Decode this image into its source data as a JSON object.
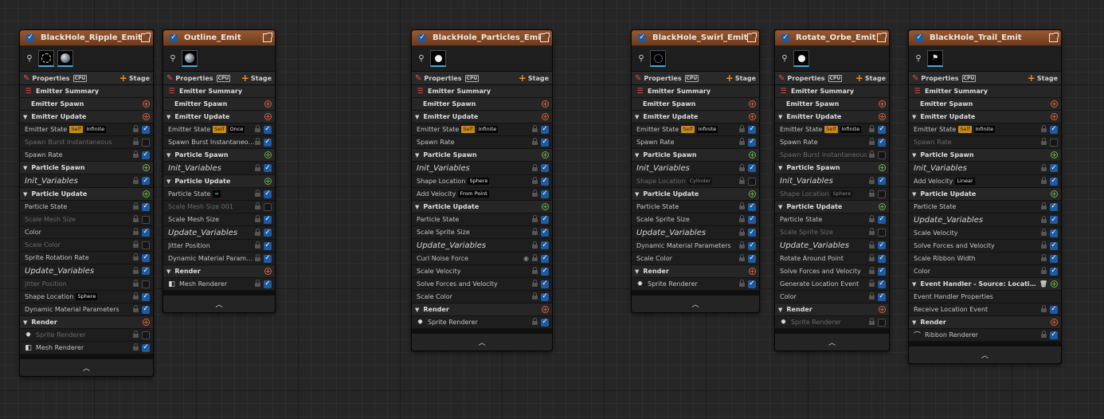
{
  "emitters": [
    {
      "title": "BlackHole_Ripple_Emit",
      "thumb": "ripple",
      "properties_label": "Properties",
      "cpu_label": "CPU",
      "stage_label": "Stage",
      "rows": [
        {
          "kind": "summary",
          "label": "Emitter Summary"
        },
        {
          "kind": "spawnh",
          "label": "Emitter Spawn",
          "add": "red"
        },
        {
          "kind": "header",
          "label": "Emitter Update",
          "add": "red"
        },
        {
          "kind": "item",
          "label": "Emitter State",
          "self": "Self",
          "badge": "Infinite",
          "checked": true
        },
        {
          "kind": "item",
          "label": "Spawn Burst Instantaneous",
          "dim": true,
          "checked": false
        },
        {
          "kind": "item",
          "label": "Spawn Rate",
          "checked": true
        },
        {
          "kind": "header",
          "label": "Particle Spawn",
          "add": "green"
        },
        {
          "kind": "item",
          "label": "Init_Variables",
          "italic": true,
          "checked": true
        },
        {
          "kind": "header",
          "label": "Particle Update",
          "add": "green"
        },
        {
          "kind": "item",
          "label": "Particle State",
          "checked": true
        },
        {
          "kind": "item",
          "label": "Scale Mesh Size",
          "dim": true,
          "checked": false
        },
        {
          "kind": "item",
          "label": "Color",
          "checked": true
        },
        {
          "kind": "item",
          "label": "Scale Color",
          "dim": true,
          "checked": false
        },
        {
          "kind": "item",
          "label": "Sprite Rotation Rate",
          "checked": true
        },
        {
          "kind": "item",
          "label": "Update_Variables",
          "italic": true,
          "checked": true
        },
        {
          "kind": "item",
          "label": "Jitter Position",
          "dim": true,
          "checked": false
        },
        {
          "kind": "item",
          "label": "Shape Location",
          "badge": "Sphere",
          "checked": true
        },
        {
          "kind": "item",
          "label": "Dynamic Material Parameters",
          "checked": true
        },
        {
          "kind": "header",
          "label": "Render",
          "add": "red"
        },
        {
          "kind": "item",
          "label": "Sprite Renderer",
          "icon": "sprite-icon",
          "dim": true,
          "checked": false
        },
        {
          "kind": "item",
          "label": "Mesh Renderer",
          "icon": "mesh-icon",
          "checked": true
        }
      ]
    },
    {
      "title": "Outline_Emit",
      "thumb": "sphere",
      "properties_label": "Properties",
      "cpu_label": "CPU",
      "stage_label": "Stage",
      "rows": [
        {
          "kind": "summary",
          "label": "Emitter Summary"
        },
        {
          "kind": "spawnh",
          "label": "Emitter Spawn",
          "add": "red"
        },
        {
          "kind": "header",
          "label": "Emitter Update",
          "add": "red"
        },
        {
          "kind": "item",
          "label": "Emitter State",
          "self": "Self",
          "badge": "Once",
          "checked": true
        },
        {
          "kind": "item",
          "label": "Spawn Burst Instantaneous",
          "checked": true
        },
        {
          "kind": "header",
          "label": "Particle Spawn",
          "add": "green"
        },
        {
          "kind": "item",
          "label": "Init_Variables",
          "italic": true,
          "checked": true
        },
        {
          "kind": "header",
          "label": "Particle Update",
          "add": "green"
        },
        {
          "kind": "item",
          "label": "Particle State",
          "badge": "∞",
          "badgeInf": true,
          "checked": true
        },
        {
          "kind": "item",
          "label": "Scale Mesh Size 001",
          "dim": true,
          "checked": false
        },
        {
          "kind": "item",
          "label": "Scale Mesh Size",
          "checked": true
        },
        {
          "kind": "item",
          "label": "Update_Variables",
          "italic": true,
          "checked": true
        },
        {
          "kind": "item",
          "label": "Jitter Position",
          "checked": true
        },
        {
          "kind": "item",
          "label": "Dynamic Material Parameters",
          "checked": true
        },
        {
          "kind": "header",
          "label": "Render",
          "add": "red"
        },
        {
          "kind": "item",
          "label": "Mesh Renderer",
          "icon": "mesh-icon",
          "checked": true
        }
      ]
    },
    {
      "title": "BlackHole_Particles_Emit",
      "thumb": "dot",
      "properties_label": "Properties",
      "cpu_label": "CPU",
      "stage_label": "Stage",
      "rows": [
        {
          "kind": "summary",
          "label": "Emitter Summary"
        },
        {
          "kind": "spawnh",
          "label": "Emitter Spawn",
          "add": "red"
        },
        {
          "kind": "header",
          "label": "Emitter Update",
          "add": "red"
        },
        {
          "kind": "item",
          "label": "Emitter State",
          "self": "Self",
          "badge": "Infinite",
          "checked": true
        },
        {
          "kind": "item",
          "label": "Spawn Rate",
          "checked": true
        },
        {
          "kind": "header",
          "label": "Particle Spawn",
          "add": "green"
        },
        {
          "kind": "item",
          "label": "Init_Variables",
          "italic": true,
          "checked": true
        },
        {
          "kind": "item",
          "label": "Shape Location",
          "badge": "Sphere",
          "checked": true
        },
        {
          "kind": "item",
          "label": "Add Velocity",
          "badge": "From Point",
          "checked": true
        },
        {
          "kind": "header",
          "label": "Particle Update",
          "add": "green"
        },
        {
          "kind": "item",
          "label": "Particle State",
          "checked": true
        },
        {
          "kind": "item",
          "label": "Scale Sprite Size",
          "checked": true
        },
        {
          "kind": "item",
          "label": "Update_Variables",
          "italic": true,
          "checked": true
        },
        {
          "kind": "item",
          "label": "Curl Noise Force",
          "eye": true,
          "checked": true
        },
        {
          "kind": "item",
          "label": "Scale Velocity",
          "checked": true
        },
        {
          "kind": "item",
          "label": "Solve Forces and Velocity",
          "checked": true
        },
        {
          "kind": "item",
          "label": "Scale Color",
          "checked": true
        },
        {
          "kind": "header",
          "label": "Render",
          "add": "red"
        },
        {
          "kind": "item",
          "label": "Sprite Renderer",
          "icon": "sprite-icon",
          "checked": true
        }
      ]
    },
    {
      "title": "BlackHole_Swirl_Emit",
      "thumb": "swirl",
      "properties_label": "Properties",
      "cpu_label": "CPU",
      "stage_label": "Stage",
      "rows": [
        {
          "kind": "summary",
          "label": "Emitter Summary"
        },
        {
          "kind": "spawnh",
          "label": "Emitter Spawn",
          "add": "red"
        },
        {
          "kind": "header",
          "label": "Emitter Update",
          "add": "red"
        },
        {
          "kind": "item",
          "label": "Emitter State",
          "self": "Self",
          "badge": "Infinite",
          "checked": true
        },
        {
          "kind": "item",
          "label": "Spawn Rate",
          "checked": true
        },
        {
          "kind": "header",
          "label": "Particle Spawn",
          "add": "green"
        },
        {
          "kind": "item",
          "label": "Init_Variables",
          "italic": true,
          "checked": true
        },
        {
          "kind": "item",
          "label": "Shape Location",
          "badge": "Cylinder",
          "dim": true,
          "checked": false
        },
        {
          "kind": "header",
          "label": "Particle Update",
          "add": "green"
        },
        {
          "kind": "item",
          "label": "Particle State",
          "checked": true
        },
        {
          "kind": "item",
          "label": "Scale Sprite Size",
          "checked": true
        },
        {
          "kind": "item",
          "label": "Update_Variables",
          "italic": true,
          "checked": true
        },
        {
          "kind": "item",
          "label": "Dynamic Material Parameters",
          "checked": true
        },
        {
          "kind": "item",
          "label": "Scale Color",
          "checked": true
        },
        {
          "kind": "header",
          "label": "Render",
          "add": "red"
        },
        {
          "kind": "item",
          "label": "Sprite Renderer",
          "icon": "sprite-icon",
          "checked": true
        }
      ]
    },
    {
      "title": "Rotate_Orbe_Emit",
      "thumb": "dot",
      "properties_label": "Properties",
      "cpu_label": "CPU",
      "stage_label": "Stage",
      "rows": [
        {
          "kind": "summary",
          "label": "Emitter Summary"
        },
        {
          "kind": "spawnh",
          "label": "Emitter Spawn",
          "add": "red"
        },
        {
          "kind": "header",
          "label": "Emitter Update",
          "add": "red"
        },
        {
          "kind": "item",
          "label": "Emitter State",
          "self": "Self",
          "badge": "Infinite",
          "checked": true
        },
        {
          "kind": "item",
          "label": "Spawn Rate",
          "checked": true
        },
        {
          "kind": "item",
          "label": "Spawn Burst Instantaneous",
          "dim": true,
          "checked": false
        },
        {
          "kind": "header",
          "label": "Particle Spawn",
          "add": "green"
        },
        {
          "kind": "item",
          "label": "Init_Variables",
          "italic": true,
          "checked": true
        },
        {
          "kind": "item",
          "label": "Shape Location",
          "badge": "Sphere",
          "dim": true,
          "checked": false
        },
        {
          "kind": "header",
          "label": "Particle Update",
          "add": "green"
        },
        {
          "kind": "item",
          "label": "Particle State",
          "checked": true
        },
        {
          "kind": "item",
          "label": "Scale Sprite Size",
          "dim": true,
          "checked": false
        },
        {
          "kind": "item",
          "label": "Update_Variables",
          "italic": true,
          "checked": true
        },
        {
          "kind": "item",
          "label": "Rotate Around Point",
          "checked": true
        },
        {
          "kind": "item",
          "label": "Solve Forces and Velocity",
          "checked": true
        },
        {
          "kind": "item",
          "label": "Generate Location Event",
          "checked": true
        },
        {
          "kind": "item",
          "label": "Color",
          "checked": true
        },
        {
          "kind": "header",
          "label": "Render",
          "add": "red"
        },
        {
          "kind": "item",
          "label": "Sprite Renderer",
          "icon": "sprite-icon",
          "dim": true,
          "checked": false
        }
      ]
    },
    {
      "title": "BlackHole_Trail_Emit",
      "thumb": "trail",
      "properties_label": "Properties",
      "cpu_label": "CPU",
      "stage_label": "Stage",
      "rows": [
        {
          "kind": "summary",
          "label": "Emitter Summary"
        },
        {
          "kind": "spawnh",
          "label": "Emitter Spawn",
          "add": "red"
        },
        {
          "kind": "header",
          "label": "Emitter Update",
          "add": "red"
        },
        {
          "kind": "item",
          "label": "Emitter State",
          "self": "Self",
          "badge": "Infinite",
          "checked": true
        },
        {
          "kind": "item",
          "label": "Spawn Rate",
          "dim": true,
          "checked": false
        },
        {
          "kind": "header",
          "label": "Particle Spawn",
          "add": "green"
        },
        {
          "kind": "item",
          "label": "Init_Variables",
          "italic": true,
          "checked": true
        },
        {
          "kind": "item",
          "label": "Add Velocity",
          "badge": "Linear",
          "checked": true
        },
        {
          "kind": "header",
          "label": "Particle Update",
          "add": "green"
        },
        {
          "kind": "item",
          "label": "Particle State",
          "checked": true
        },
        {
          "kind": "item",
          "label": "Update_Variables",
          "italic": true,
          "checked": true
        },
        {
          "kind": "item",
          "label": "Scale Velocity",
          "checked": true
        },
        {
          "kind": "item",
          "label": "Solve Forces and Velocity",
          "checked": true
        },
        {
          "kind": "item",
          "label": "Scale Ribbon Width",
          "checked": true
        },
        {
          "kind": "item",
          "label": "Color",
          "checked": true
        },
        {
          "kind": "header",
          "label": "Event Handler - Source: LocationEvent",
          "add": "green",
          "trash": true
        },
        {
          "kind": "item",
          "label": "Event Handler Properties",
          "nocheck": true
        },
        {
          "kind": "item",
          "label": "Receive Location Event",
          "checked": true
        },
        {
          "kind": "header",
          "label": "Render",
          "add": "red"
        },
        {
          "kind": "item",
          "label": "Ribbon Renderer",
          "icon": "ribbon-icon",
          "checked": true
        }
      ]
    }
  ]
}
